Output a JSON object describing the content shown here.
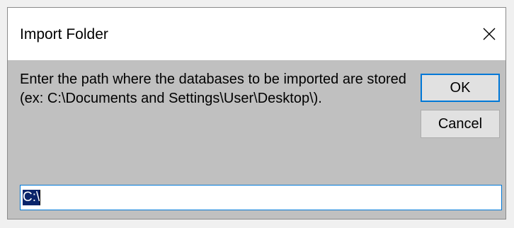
{
  "window": {
    "title": "Import Folder",
    "close_icon": "close-icon"
  },
  "prompt": {
    "text": "Enter the path where the databases to be imported are stored (ex: C:\\Documents and Settings\\User\\Desktop\\)."
  },
  "buttons": {
    "ok_label": "OK",
    "cancel_label": "Cancel"
  },
  "path_input": {
    "value": "C:\\",
    "selected": true
  },
  "colors": {
    "dialog_background": "#c0c0c0",
    "titlebar_background": "#ffffff",
    "accent": "#0078d7",
    "selection": "#0a246a"
  }
}
